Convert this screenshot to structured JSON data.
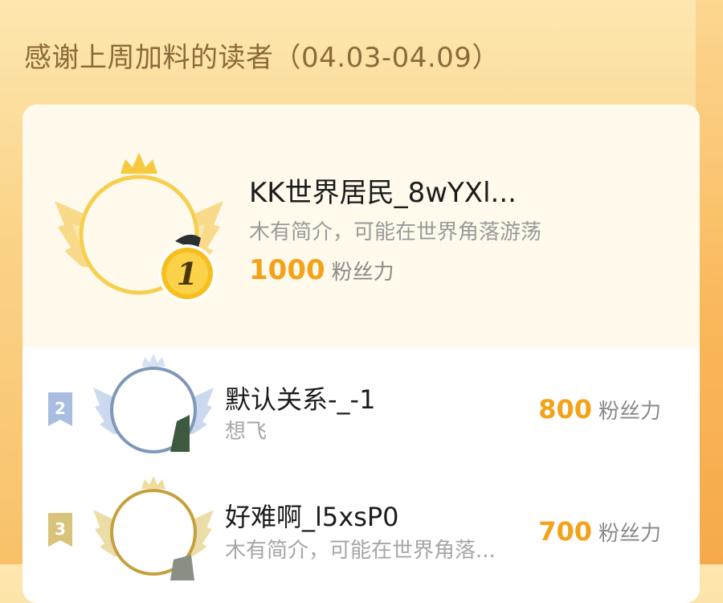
{
  "header": {
    "title": "感谢上周加料的读者（04.03-04.09）"
  },
  "top_reader": {
    "rank": "1",
    "name": "KK世界居民_8wYXl...",
    "bio": "木有简介，可能在世界角落游荡",
    "fans_value": "1000",
    "fans_label": "粉丝力"
  },
  "readers": [
    {
      "rank": "2",
      "name": "默认关系-_-1",
      "bio": "想飞",
      "fans_value": "800",
      "fans_label": "粉丝力"
    },
    {
      "rank": "3",
      "name": "好难啊_l5xsP0",
      "bio": "木有简介，可能在世界角落...",
      "fans_value": "700",
      "fans_label": "粉丝力"
    }
  ],
  "colors": {
    "accent_orange": "#f4a21a",
    "gold": "#f7c93f",
    "silver_blue": "#7f97b8",
    "bronze": "#c6a03f"
  },
  "icons": [
    "crown-icon",
    "wings-icon",
    "rank-medal-icon",
    "rank-flag-icon",
    "avatar"
  ]
}
